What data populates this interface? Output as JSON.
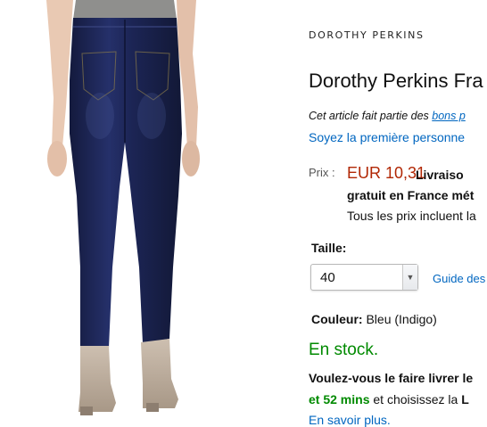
{
  "brand": {
    "logo_text": "DOROTHY PERKINS"
  },
  "product": {
    "title": "Dorothy Perkins Fra",
    "collection_note_prefix": "Cet article fait partie des ",
    "collection_note_link": "bons p",
    "review_link": "Soyez la première personne"
  },
  "price": {
    "label": "Prix :",
    "value": "EUR 10,31",
    "shipping_line1": "Livraiso",
    "shipping_line2": "gratuit en France mét",
    "tax_note": "Tous les prix incluent la"
  },
  "size": {
    "label": "Taille:",
    "selected": "40",
    "guide_link": "Guide des"
  },
  "color": {
    "label": "Couleur:",
    "value": "Bleu (Indigo)"
  },
  "stock": {
    "status": "En stock."
  },
  "delivery": {
    "line1": "Voulez-vous le faire livrer le",
    "time": "et 52 mins",
    "line2_mid": " et choisissez la ",
    "line2_end": "L",
    "learn_more": "En savoir plus."
  },
  "colors": {
    "price": "#b12704",
    "link": "#0066c0",
    "stock": "#008a00",
    "denim": "#1b2452"
  }
}
